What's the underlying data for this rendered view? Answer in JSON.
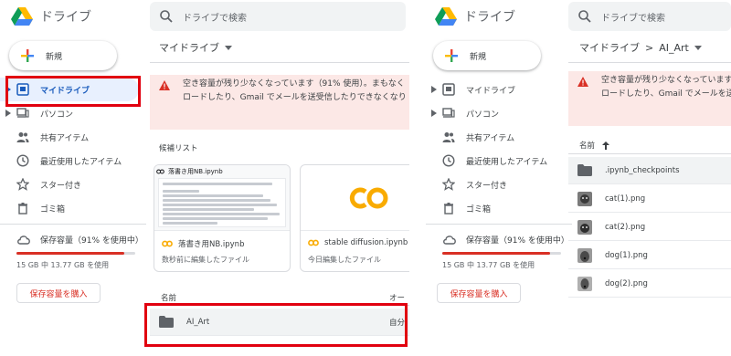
{
  "colors": {
    "accent_blue": "#185abc",
    "active_bg": "#e8f0fe",
    "warning_bg": "#fce8e6",
    "warning_red": "#d93025",
    "highlight_red": "#e1000f",
    "search_bg": "#f1f3f4"
  },
  "left_panel": {
    "app_title": "ドライブ",
    "search_placeholder": "ドライブで検索",
    "new_button": "新規",
    "nav": [
      {
        "label": "マイドライブ",
        "icon": "my-drive-icon",
        "active": true
      },
      {
        "label": "パソコン",
        "icon": "computer-icon"
      },
      {
        "label": "共有アイテム",
        "icon": "shared-icon"
      },
      {
        "label": "最近使用したアイテム",
        "icon": "clock-icon"
      },
      {
        "label": "スター付き",
        "icon": "star-icon"
      },
      {
        "label": "ゴミ箱",
        "icon": "trash-icon"
      }
    ],
    "storage": {
      "label": "保存容量（91% を使用中）",
      "used_text": "15 GB 中 13.77 GB を使用",
      "buy_button": "保存容量を購入",
      "percent_used": 91
    },
    "header": "マイドライブ",
    "warning": {
      "line1": "空き容量が残り少なくなっています（91% 使用）。まもなく",
      "line2": "ロードしたり、Gmail でメールを送受信したりできなくなり"
    },
    "suggested_label": "候補リスト",
    "cards": [
      {
        "name": "落書き用NB.ipynb",
        "subtitle": "数秒前に編集したファイル",
        "thumb_title": "落書き用NB.ipynb",
        "icon": "colab-icon"
      },
      {
        "name": "stable diffusion.ipynb",
        "subtitle": "今日編集したファイル",
        "icon": "colab-icon"
      }
    ],
    "list_header": {
      "name": "名前",
      "owner": "オー"
    },
    "folder_row": {
      "name": "AI_Art",
      "owner": "自分"
    }
  },
  "right_panel": {
    "app_title": "ドライブ",
    "search_placeholder": "ドライブで検索",
    "new_button": "新規",
    "nav": [
      {
        "label": "マイドライブ",
        "icon": "my-drive-icon"
      },
      {
        "label": "パソコン",
        "icon": "computer-icon"
      },
      {
        "label": "共有アイテム",
        "icon": "shared-icon"
      },
      {
        "label": "最近使用したアイテム",
        "icon": "clock-icon"
      },
      {
        "label": "スター付き",
        "icon": "star-icon"
      },
      {
        "label": "ゴミ箱",
        "icon": "trash-icon"
      }
    ],
    "storage": {
      "label": "保存容量（91% を使用中）",
      "used_text": "15 GB 中 13.77 GB を使用",
      "buy_button": "保存容量を購入",
      "percent_used": 91
    },
    "breadcrumb": {
      "root": "マイドライブ",
      "sep": ">",
      "current": "AI_Art"
    },
    "warning": {
      "line1": "空き容量が残り少なくなっています",
      "line2": "ロードしたり、Gmail でメールを送"
    },
    "list_header": {
      "name": "名前",
      "sort_icon": "arrow-up-icon"
    },
    "files": [
      {
        "name": ".ipynb_checkpoints",
        "type": "folder"
      },
      {
        "name": "cat(1).png",
        "type": "image"
      },
      {
        "name": "cat(2).png",
        "type": "image"
      },
      {
        "name": "dog(1).png",
        "type": "image"
      },
      {
        "name": "dog(2).png",
        "type": "image"
      }
    ]
  }
}
